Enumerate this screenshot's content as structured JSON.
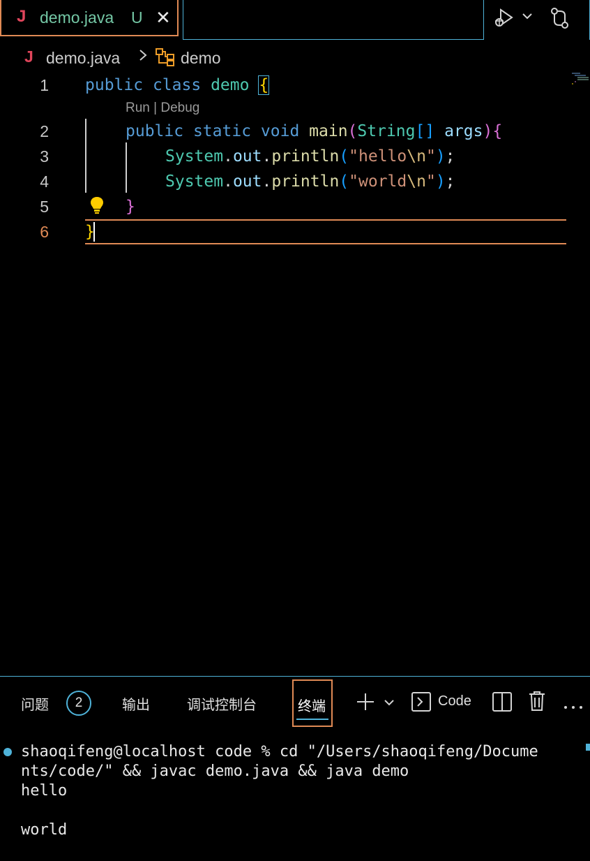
{
  "tab": {
    "icon_label": "J",
    "filename": "demo.java",
    "status": "U"
  },
  "toolbar": {
    "run_debug_icon": "run-debug-icon",
    "compare_icon": "git-compare-icon"
  },
  "breadcrumb": {
    "icon_label": "J",
    "file": "demo.java",
    "symbol": "demo"
  },
  "editor": {
    "line_numbers": [
      "1",
      "2",
      "3",
      "4",
      "5",
      "6"
    ],
    "codelens": "Run | Debug",
    "lines": {
      "l1": {
        "kw1": "public",
        "kw2": "class",
        "name": "demo",
        "brace": "{"
      },
      "l2": {
        "kw1": "public",
        "kw2": "static",
        "kw3": "void",
        "fn": "main",
        "p1": "(",
        "type": "String",
        "arr": "[]",
        "arg": "args",
        "p2": ")",
        "brace": "{"
      },
      "l3": {
        "obj": "System",
        "dot1": ".",
        "field": "out",
        "dot2": ".",
        "fn": "println",
        "p1": "(",
        "str1": "\"hello",
        "esc": "\\n",
        "str2": "\"",
        "p2": ")",
        "semi": ";"
      },
      "l4": {
        "obj": "System",
        "dot1": ".",
        "field": "out",
        "dot2": ".",
        "fn": "println",
        "p1": "(",
        "str1": "\"world",
        "esc": "\\n",
        "str2": "\"",
        "p2": ")",
        "semi": ";"
      },
      "l5": {
        "brace": "}"
      },
      "l6": {
        "brace": "}"
      }
    }
  },
  "panel": {
    "tabs": {
      "problems": "问题",
      "problems_count": "2",
      "output": "输出",
      "debug_console": "调试控制台",
      "terminal": "终端"
    },
    "terminal_name": "Code",
    "terminal_lines": [
      "shaoqifeng@localhost code % cd \"/Users/shaoqifeng/Docume",
      "nts/code/\" && javac demo.java && java demo",
      "hello",
      "",
      "world"
    ]
  }
}
